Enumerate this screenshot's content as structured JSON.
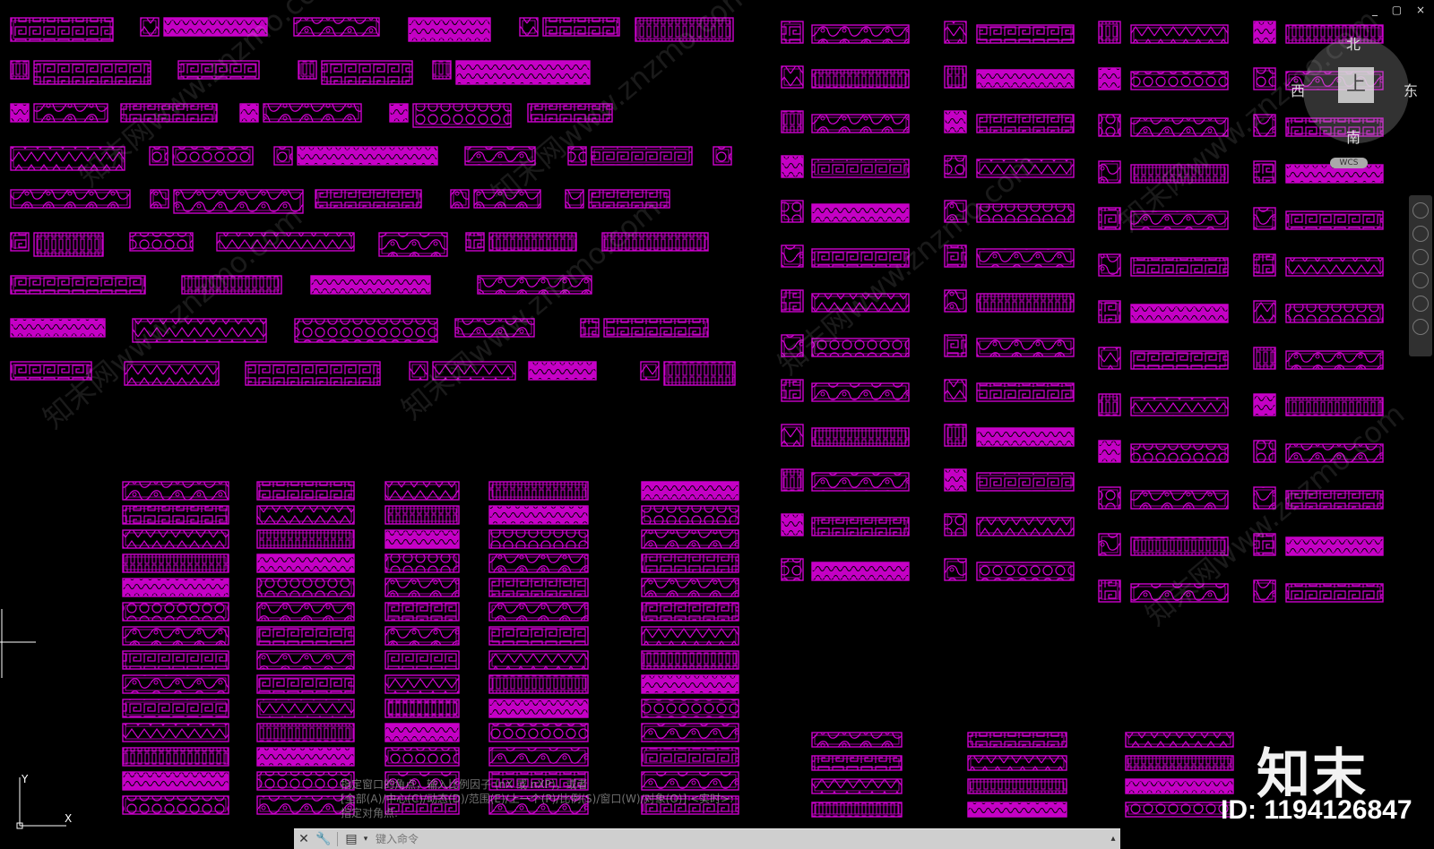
{
  "drawing": {
    "accent_color": "#cc00cc",
    "fill_color": "#e600e6",
    "background_color": "#000000",
    "watermark_text": "知末网www.znzmo.com"
  },
  "window_controls": {
    "minimize": "_",
    "restore": "▢",
    "close": "×"
  },
  "viewcube": {
    "north": "北",
    "south": "南",
    "west": "西",
    "east": "东",
    "top_face": "上",
    "wcs": "WCS"
  },
  "command_history": {
    "line1": "指定窗口的角点，输入比例因子 (nX 或 nXP)，或者",
    "line2": "[全部(A)/中心(C)/动态(D)/范围(E)/上一个(P)/比例(S)/窗口(W)/对象(O)] <实时>:",
    "line3": "指定对角点:"
  },
  "command_line": {
    "placeholder": "键入命令"
  },
  "ucs": {
    "x_label": "X",
    "y_label": "Y"
  },
  "brand": {
    "logo_text": "知末",
    "id_text": "ID: 1194126847"
  }
}
